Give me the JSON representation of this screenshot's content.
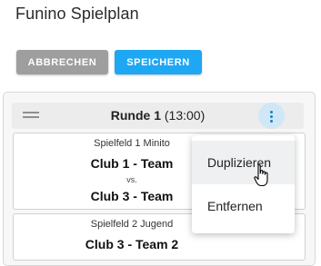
{
  "page": {
    "title": "Funino Spielplan"
  },
  "toolbar": {
    "cancel_label": "ABBRECHEN",
    "save_label": "SPEICHERN"
  },
  "round": {
    "name": "Runde 1",
    "time": "(13:00)",
    "menu_icon": "more-vertical-icon",
    "drag_icon": "drag-handle-icon"
  },
  "matches": [
    {
      "field": "Spielfeld 1 Minito",
      "home": "Club 1 - Team",
      "vs": "vs.",
      "away": "Club 3 - Team"
    },
    {
      "field": "Spielfeld 2 Jugend",
      "home": "Club 3 - Team 2"
    }
  ],
  "context_menu": {
    "items": [
      {
        "label": "Duplizieren"
      },
      {
        "label": "Entfernen"
      }
    ]
  },
  "colors": {
    "primary": "#1ea7f2",
    "secondary": "#9e9e9e",
    "menu_highlight": "#eef0f1",
    "icon_blue": "#1581c6"
  }
}
